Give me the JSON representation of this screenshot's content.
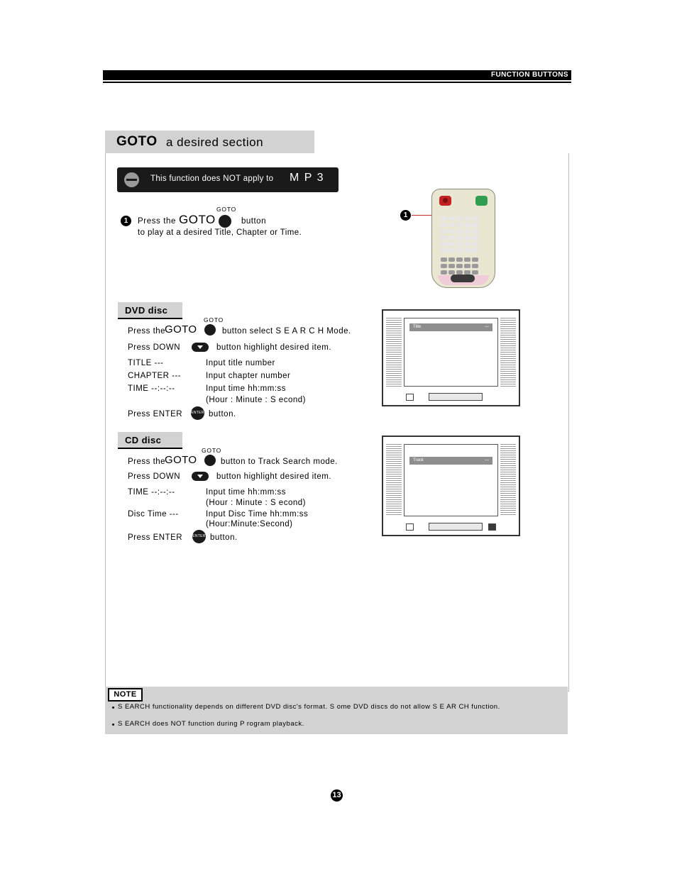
{
  "header": {
    "label": "FUNCTION BUTTONS"
  },
  "section": {
    "title_bold": "GOTO",
    "title_rest": "a desired  section"
  },
  "notice": {
    "text": "This function does NOT apply to",
    "format": "M P 3"
  },
  "step1": {
    "badge": "1",
    "goto_small": "GOTO",
    "line1_prefix": "Press the",
    "goto_word": "GOTO",
    "line1_suffix": "button",
    "line2": "to play at  a desired Title, Chapter or  Time."
  },
  "remote": {
    "badge": "1"
  },
  "dvd": {
    "label": "DVD disc",
    "goto_small": "GOTO",
    "r1_prefix": "Press the",
    "r1_goto": "GOTO",
    "r1_suffix": "button select S E A R C H  Mode.",
    "r2_prefix": "Press  DOWN",
    "r2_suffix": "button highlight desired  item.",
    "rows": [
      {
        "left": "TITLE ---",
        "right": "Input title   number"
      },
      {
        "left": "CHAPTER ---",
        "right": "Input chapter   number"
      },
      {
        "left": "TIME --:--:--",
        "right": "Input time   hh:mm:ss"
      }
    ],
    "hms_note": "(Hour :   Minute :   S econd)",
    "enter_prefix": "Press  ENTER",
    "enter_btn_label": "ENTER",
    "enter_suffix": "button.",
    "tv_osd_title": "Title",
    "tv_osd_right": "---"
  },
  "cd": {
    "label": "CD disc",
    "goto_small": "GOTO",
    "r1_prefix": "Press the",
    "r1_goto": "GOTO",
    "r1_suffix": "button to Track Search mode.",
    "r2_prefix": "Press  DOWN",
    "r2_suffix": "button highlight desired  item.",
    "rows": [
      {
        "left": "TIME --:--:--",
        "right": "Input time   hh:mm:ss"
      },
      {
        "left": "Disc Time ---",
        "right": "Input Disc Time hh:mm:ss"
      }
    ],
    "hms_note1": "(Hour :   Minute :   S econd)",
    "hms_note2": "(Hour:Minute:Second)",
    "enter_prefix": "Press  ENTER",
    "enter_btn_label": "ENTER",
    "enter_suffix": "button.",
    "tv_osd_title": "Track",
    "tv_osd_right": "---"
  },
  "note": {
    "tag": "NOTE",
    "lines": [
      "S EARCH functionality depends on different DVD  disc's format. S ome    DVD discs do  not allow S E AR CH   function.",
      "S EARCH does  NOT   function during P rogram  playback."
    ]
  },
  "page": {
    "number": "13"
  }
}
